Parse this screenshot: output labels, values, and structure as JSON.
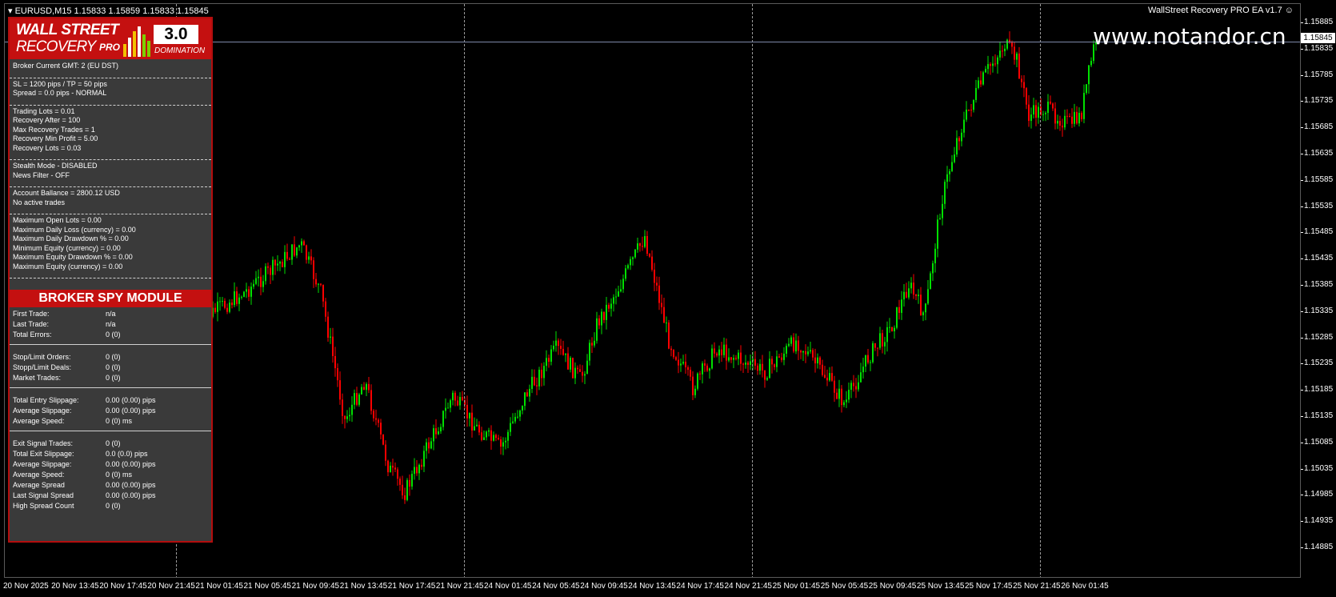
{
  "header": {
    "symbol_line": "EURUSD,M15  1.15833 1.15859 1.15833 1.15845",
    "ea_label": "WallStreet Recovery PRO EA v1.7"
  },
  "watermark": "www.notandor.cn",
  "price_axis": {
    "current_price": "1.15845",
    "ticks": [
      "1.15885",
      "1.15835",
      "1.15785",
      "1.15735",
      "1.15685",
      "1.15635",
      "1.15585",
      "1.15535",
      "1.15485",
      "1.15435",
      "1.15385",
      "1.15335",
      "1.15285",
      "1.15235",
      "1.15185",
      "1.15135",
      "1.15085",
      "1.15035",
      "1.14985",
      "1.14935",
      "1.14885"
    ]
  },
  "time_axis": {
    "ticks": [
      "20 Nov 2025",
      "20 Nov 13:45",
      "20 Nov 17:45",
      "20 Nov 21:45",
      "21 Nov 01:45",
      "21 Nov 05:45",
      "21 Nov 09:45",
      "21 Nov 13:45",
      "21 Nov 17:45",
      "21 Nov 21:45",
      "24 Nov 01:45",
      "24 Nov 05:45",
      "24 Nov 09:45",
      "24 Nov 13:45",
      "24 Nov 17:45",
      "24 Nov 21:45",
      "25 Nov 01:45",
      "25 Nov 05:45",
      "25 Nov 09:45",
      "25 Nov 13:45",
      "25 Nov 17:45",
      "25 Nov 21:45",
      "26 Nov 01:45"
    ]
  },
  "colors": {
    "bull": "#00e000",
    "bear": "#ff0000",
    "panel_red": "#c41010",
    "panel_bg": "#3a3a3a"
  },
  "panel": {
    "logo": {
      "line1": "WALL STREET",
      "line2": "RECOVERY",
      "pro": "PRO",
      "version": "3.0",
      "tagline": "DOMINATION"
    },
    "sections": [
      [
        "Broker Current GMT: 2 (EU DST)"
      ],
      [
        "SL = 1200 pips / TP = 50 pips",
        "Spread = 0.0 pips - NORMAL"
      ],
      [
        "Trading Lots = 0.01",
        "Recovery After = 100",
        "Max Recovery Trades = 1",
        "Recovery Min Profit = 5.00",
        "Recovery Lots = 0.03"
      ],
      [
        "Stealth Mode - DISABLED",
        "News Filter - OFF"
      ],
      [
        "Account Ballance = 2800.12 USD",
        "No active trades"
      ],
      [
        "Maximum Open Lots = 0.00",
        "Maximum Daily Loss (currency) = 0.00",
        "Maximum Daily Drawdown % = 0.00",
        "Minimum Equity (currency) = 0.00",
        "Maximum Equity Drawdown % = 0.00",
        "Maximum Equity (currency) = 0.00"
      ]
    ],
    "spy_title": "BROKER SPY MODULE",
    "spy_groups": [
      [
        [
          "First Trade:",
          "n/a"
        ],
        [
          "Last Trade:",
          "n/a"
        ],
        [
          "Total Errors:",
          "0 (0)"
        ]
      ],
      [
        [
          "Stop/Limit Orders:",
          "0 (0)"
        ],
        [
          "Stopp/Limit Deals:",
          "0 (0)"
        ],
        [
          "Market Trades:",
          "0 (0)"
        ]
      ],
      [
        [
          "Total Entry Slippage:",
          "0.00 (0.00) pips"
        ],
        [
          "Average Slippage:",
          "0.00 (0.00) pips"
        ],
        [
          "Average Speed:",
          "0 (0) ms"
        ]
      ],
      [
        [
          "Exit Signal Trades:",
          "0 (0)"
        ],
        [
          "Total Exit Slippage:",
          "0.0 (0.0) pips"
        ],
        [
          "Average Slippage:",
          "0.00 (0.00) pips"
        ],
        [
          "Average Speed:",
          "0 (0) ms"
        ],
        [
          "Average Spread",
          "0.00 (0.00) pips"
        ],
        [
          "Last Signal Spread",
          "0.00 (0.00) pips"
        ],
        [
          "High Spread Count",
          "0 (0)"
        ]
      ]
    ]
  }
}
